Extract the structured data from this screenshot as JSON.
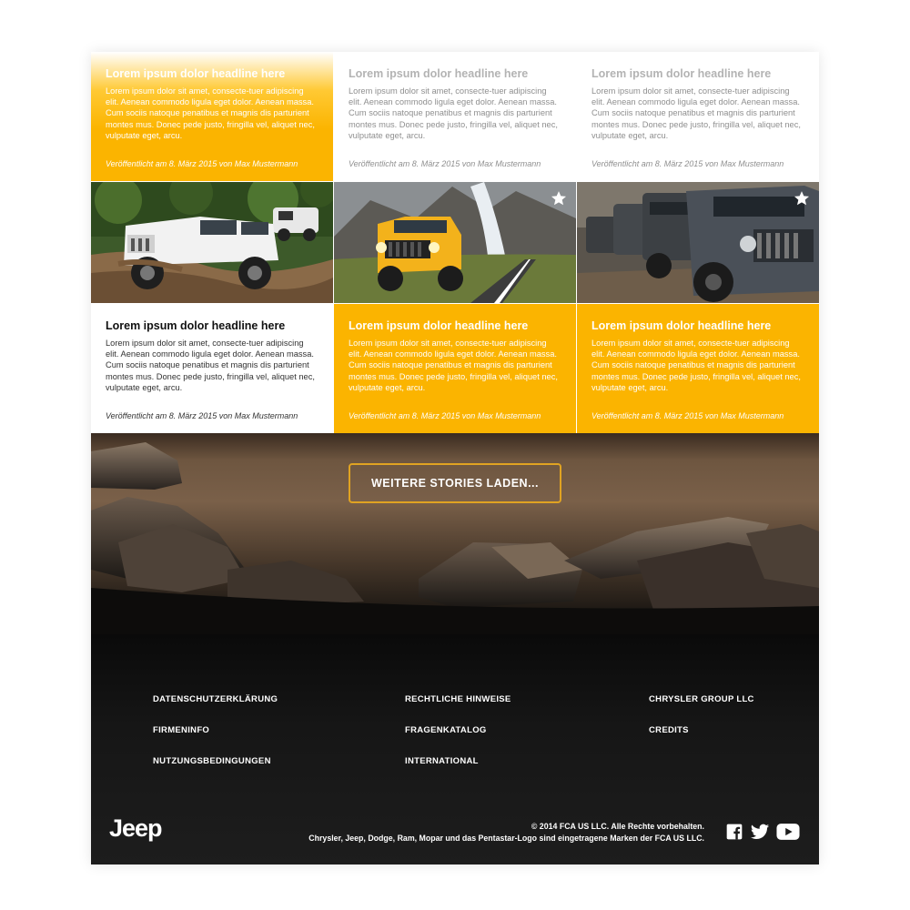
{
  "cards": [
    {
      "title": "Lorem ipsum dolor headline here",
      "body": "Lorem ipsum dolor sit amet, consecte-tuer adipiscing elit. Aenean commodo ligula eget dolor. Aenean massa. Cum sociis natoque penatibus et magnis dis parturient montes mus. Donec pede justo, fringilla vel, aliquet nec, vulputate eget, arcu.",
      "meta": "Veröffentlicht am 8. März 2015 von Max Mustermann"
    },
    {
      "title": "Lorem ipsum dolor headline here",
      "body": "Lorem ipsum dolor sit amet, consecte-tuer adipiscing elit. Aenean commodo ligula eget dolor. Aenean massa. Cum sociis natoque penatibus et magnis dis parturient montes mus. Donec pede justo, fringilla vel, aliquet nec, vulputate eget, arcu.",
      "meta": "Veröffentlicht am 8. März 2015 von Max Mustermann"
    },
    {
      "title": "Lorem ipsum dolor headline here",
      "body": "Lorem ipsum dolor sit amet, consecte-tuer adipiscing elit. Aenean commodo ligula eget dolor. Aenean massa. Cum sociis natoque penatibus et magnis dis parturient montes mus. Donec pede justo, fringilla vel, aliquet nec, vulputate eget, arcu.",
      "meta": "Veröffentlicht am 8. März 2015 von Max Mustermann"
    },
    {
      "title": "Lorem ipsum dolor headline here",
      "body": "Lorem ipsum dolor sit amet, consecte-tuer adipiscing elit. Aenean commodo ligula eget dolor. Aenean massa. Cum sociis natoque penatibus et magnis dis parturient montes mus. Donec pede justo, fringilla vel, aliquet nec, vulputate eget, arcu.",
      "meta": "Veröffentlicht am 8. März 2015 von Max Mustermann"
    },
    {
      "title": "Lorem ipsum dolor headline here",
      "body": "Lorem ipsum dolor sit amet, consecte-tuer adipiscing elit. Aenean commodo ligula eget dolor. Aenean massa. Cum sociis natoque penatibus et magnis dis parturient montes mus. Donec pede justo, fringilla vel, aliquet nec, vulputate eget, arcu.",
      "meta": "Veröffentlicht am 8. März 2015 von Max Mustermann"
    },
    {
      "title": "Lorem ipsum dolor headline here",
      "body": "Lorem ipsum dolor sit amet, consecte-tuer adipiscing elit. Aenean commodo ligula eget dolor. Aenean massa. Cum sociis natoque penatibus et magnis dis parturient montes mus. Donec pede justo, fringilla vel, aliquet nec, vulputate eget, arcu.",
      "meta": "Veröffentlicht am 8. März 2015 von Max Mustermann"
    }
  ],
  "load_more": {
    "label": "WEITERE STORIES LADEN..."
  },
  "footer": {
    "links": [
      "DATENSCHUTZERKLÄRUNG",
      "RECHTLICHE HINWEISE",
      "CHRYSLER GROUP LLC",
      "FIRMENINFO",
      "FRAGENKATALOG",
      "CREDITS",
      "NUTZUNGSBEDINGUNGEN",
      "INTERNATIONAL"
    ],
    "logo": "Jeep",
    "copyright": "© 2014 FCA US LLC. Alle Rechte vorbehalten.",
    "trademark": "Chrysler, Jeep, Dodge, Ram, Mopar und das Pentastar-Logo sind eingetragene Marken der FCA US LLC."
  },
  "colors": {
    "accent": "#fbb400",
    "button_border": "#e0a322",
    "footer_bg": "#161616"
  },
  "icons": [
    "star-icon",
    "facebook-icon",
    "twitter-icon",
    "youtube-icon"
  ]
}
